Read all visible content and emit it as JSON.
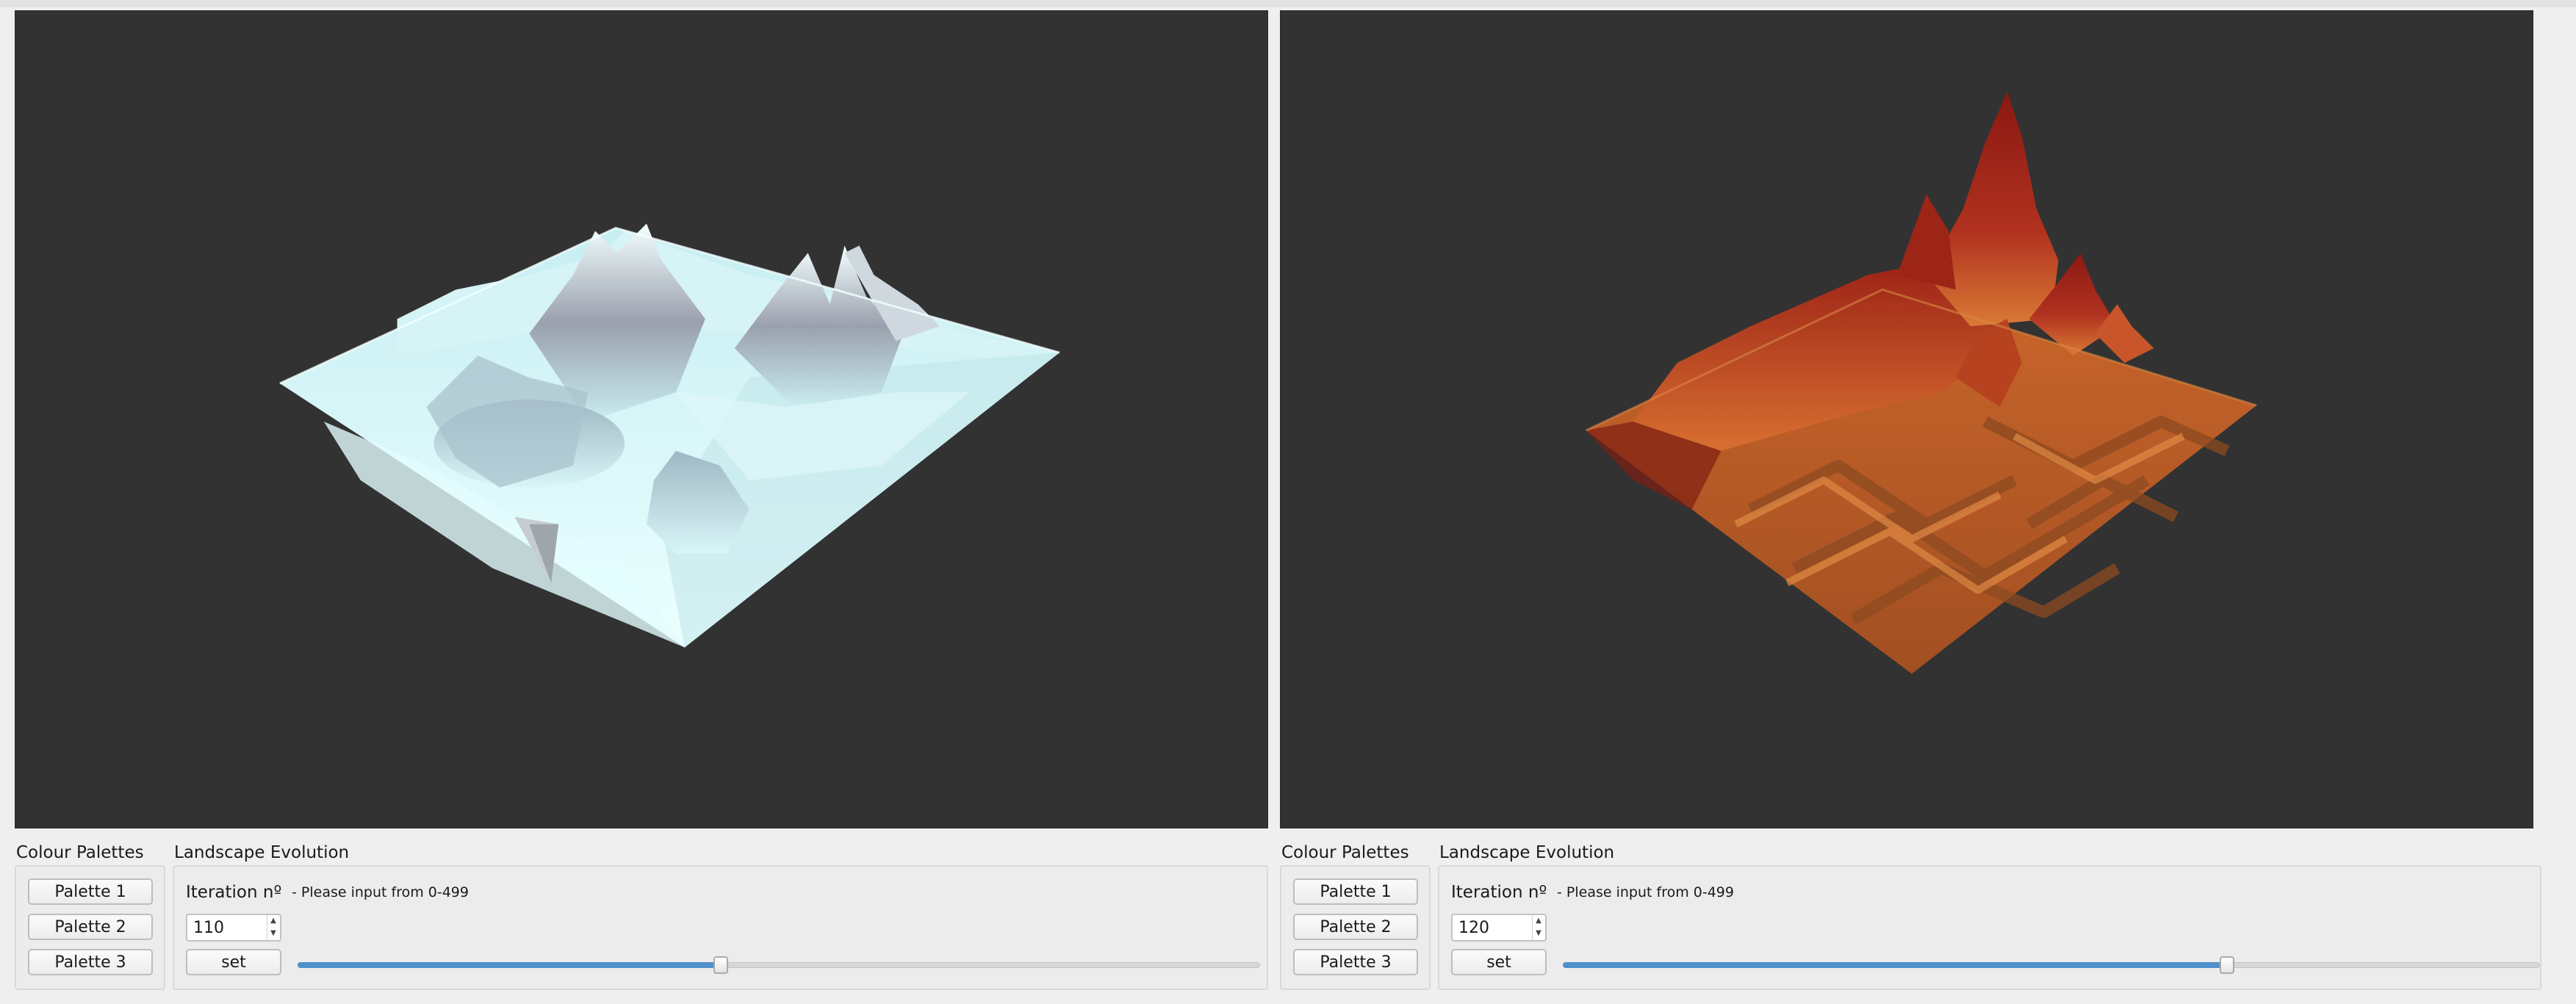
{
  "panes": [
    {
      "id": "left",
      "palette_group_title": "Colour Palettes",
      "palette_buttons": [
        "Palette 1",
        "Palette 2",
        "Palette 3"
      ],
      "evolution_group_title": "Landscape Evolution",
      "iteration_label": "Iteration nº",
      "iteration_hint": "- Please input from 0-499",
      "iteration_value": "110",
      "set_label": "set",
      "slider_fraction": 0.44,
      "viewport_palette": "ice",
      "colors": {
        "peak": "#8f95a3",
        "mid": "#b9dfe5",
        "base": "#e8fdff"
      }
    },
    {
      "id": "right",
      "palette_group_title": "Colour Palettes",
      "palette_buttons": [
        "Palette 1",
        "Palette 2",
        "Palette 3"
      ],
      "evolution_group_title": "Landscape Evolution",
      "iteration_label": "Iteration nº",
      "iteration_hint": "- Please input from 0-499",
      "iteration_value": "120",
      "set_label": "set",
      "slider_fraction": 0.68,
      "viewport_palette": "lava",
      "colors": {
        "peak": "#8a1812",
        "mid": "#b73b22",
        "base": "#d77a35"
      }
    }
  ],
  "colors": {
    "viewport_bg": "#323232",
    "slider_fill": "#4f8fcc",
    "window_bg": "#efefef"
  }
}
